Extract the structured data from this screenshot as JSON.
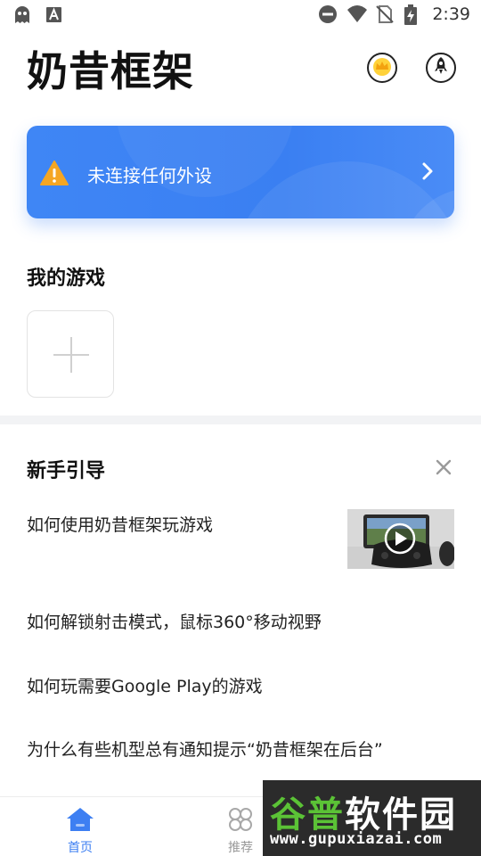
{
  "status_bar": {
    "time": "2:39",
    "left_icons": [
      "ghost-icon",
      "font-a-icon"
    ],
    "right_icons": [
      "do-not-disturb-icon",
      "wifi-icon",
      "no-sim-icon",
      "battery-charging-icon"
    ]
  },
  "header": {
    "title": "奶昔框架",
    "icons": [
      "crown-vip-icon",
      "rocket-icon"
    ]
  },
  "device_card": {
    "status_text": "未连接任何外设",
    "icon": "warning-icon",
    "accent_color": "#3d7ff2"
  },
  "my_games": {
    "title": "我的游戏",
    "add_icon": "plus-icon"
  },
  "guide": {
    "title": "新手引导",
    "items": [
      {
        "label": "如何使用奶昔框架玩游戏",
        "has_video": true
      },
      {
        "label": "如何解锁射击模式，鼠标360°移动视野"
      },
      {
        "label": "如何玩需要Google Play的游戏"
      },
      {
        "label": "为什么有些机型总有通知提示“奶昔框架在后台”"
      }
    ]
  },
  "bottom_nav": {
    "items": [
      {
        "label": "首页",
        "icon": "home-icon",
        "active": true
      },
      {
        "label": "推荐",
        "icon": "grid-icon",
        "active": false
      }
    ],
    "active_color": "#3d7ff2"
  },
  "watermark": {
    "title_part1": "谷普",
    "title_part2": "软件园",
    "url": "www.gupuxiazai.com"
  }
}
